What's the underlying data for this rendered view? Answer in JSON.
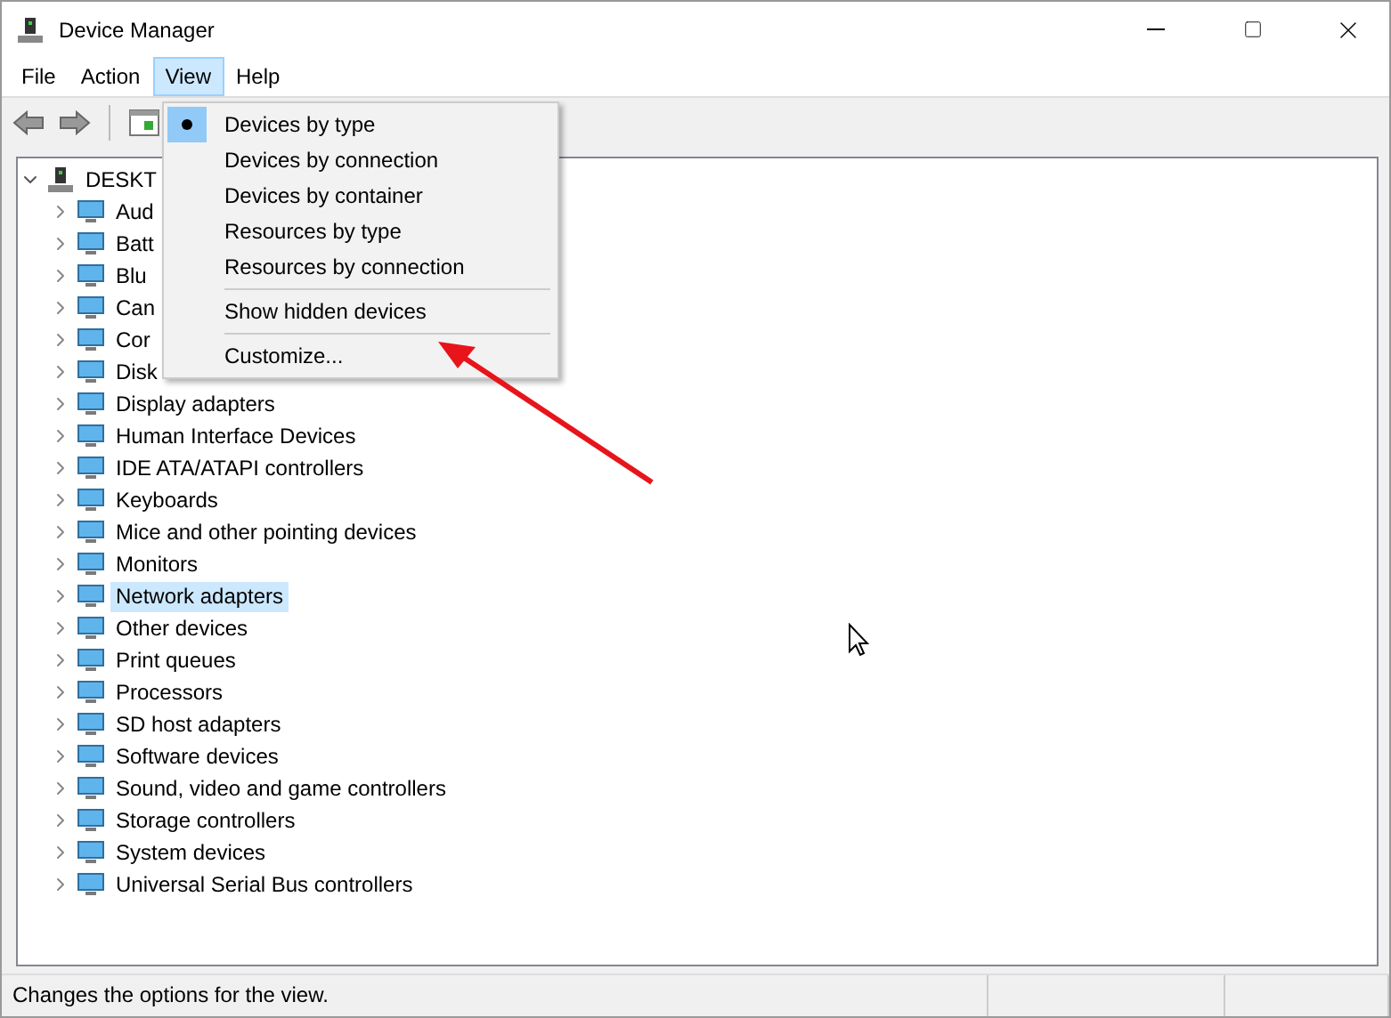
{
  "window": {
    "title": "Device Manager"
  },
  "menubar": [
    {
      "label": "File",
      "selected": false
    },
    {
      "label": "Action",
      "selected": false
    },
    {
      "label": "View",
      "selected": true
    },
    {
      "label": "Help",
      "selected": false
    }
  ],
  "view_menu": [
    {
      "label": "Devices by type",
      "checked": true,
      "separator_before": false
    },
    {
      "label": "Devices by connection",
      "checked": false,
      "separator_before": false
    },
    {
      "label": "Devices by container",
      "checked": false,
      "separator_before": false
    },
    {
      "label": "Resources by type",
      "checked": false,
      "separator_before": false
    },
    {
      "label": "Resources by connection",
      "checked": false,
      "separator_before": false
    },
    {
      "label": "Show hidden devices",
      "checked": false,
      "separator_before": true
    },
    {
      "label": "Customize...",
      "checked": false,
      "separator_before": true
    }
  ],
  "tree": {
    "label": "DESKT",
    "expanded": true,
    "children": [
      {
        "label": "Aud",
        "selected": false
      },
      {
        "label": "Batt",
        "selected": false
      },
      {
        "label": "Blu",
        "selected": false
      },
      {
        "label": "Can",
        "selected": false
      },
      {
        "label": "Cor",
        "selected": false
      },
      {
        "label": "Disk",
        "selected": false
      },
      {
        "label": "Display adapters",
        "selected": false
      },
      {
        "label": "Human Interface Devices",
        "selected": false
      },
      {
        "label": "IDE ATA/ATAPI controllers",
        "selected": false
      },
      {
        "label": "Keyboards",
        "selected": false
      },
      {
        "label": "Mice and other pointing devices",
        "selected": false
      },
      {
        "label": "Monitors",
        "selected": false
      },
      {
        "label": "Network adapters",
        "selected": true
      },
      {
        "label": "Other devices",
        "selected": false
      },
      {
        "label": "Print queues",
        "selected": false
      },
      {
        "label": "Processors",
        "selected": false
      },
      {
        "label": "SD host adapters",
        "selected": false
      },
      {
        "label": "Software devices",
        "selected": false
      },
      {
        "label": "Sound, video and game controllers",
        "selected": false
      },
      {
        "label": "Storage controllers",
        "selected": false
      },
      {
        "label": "System devices",
        "selected": false
      },
      {
        "label": "Universal Serial Bus controllers",
        "selected": false
      }
    ]
  },
  "status_bar": {
    "text": "Changes the options for the view."
  }
}
